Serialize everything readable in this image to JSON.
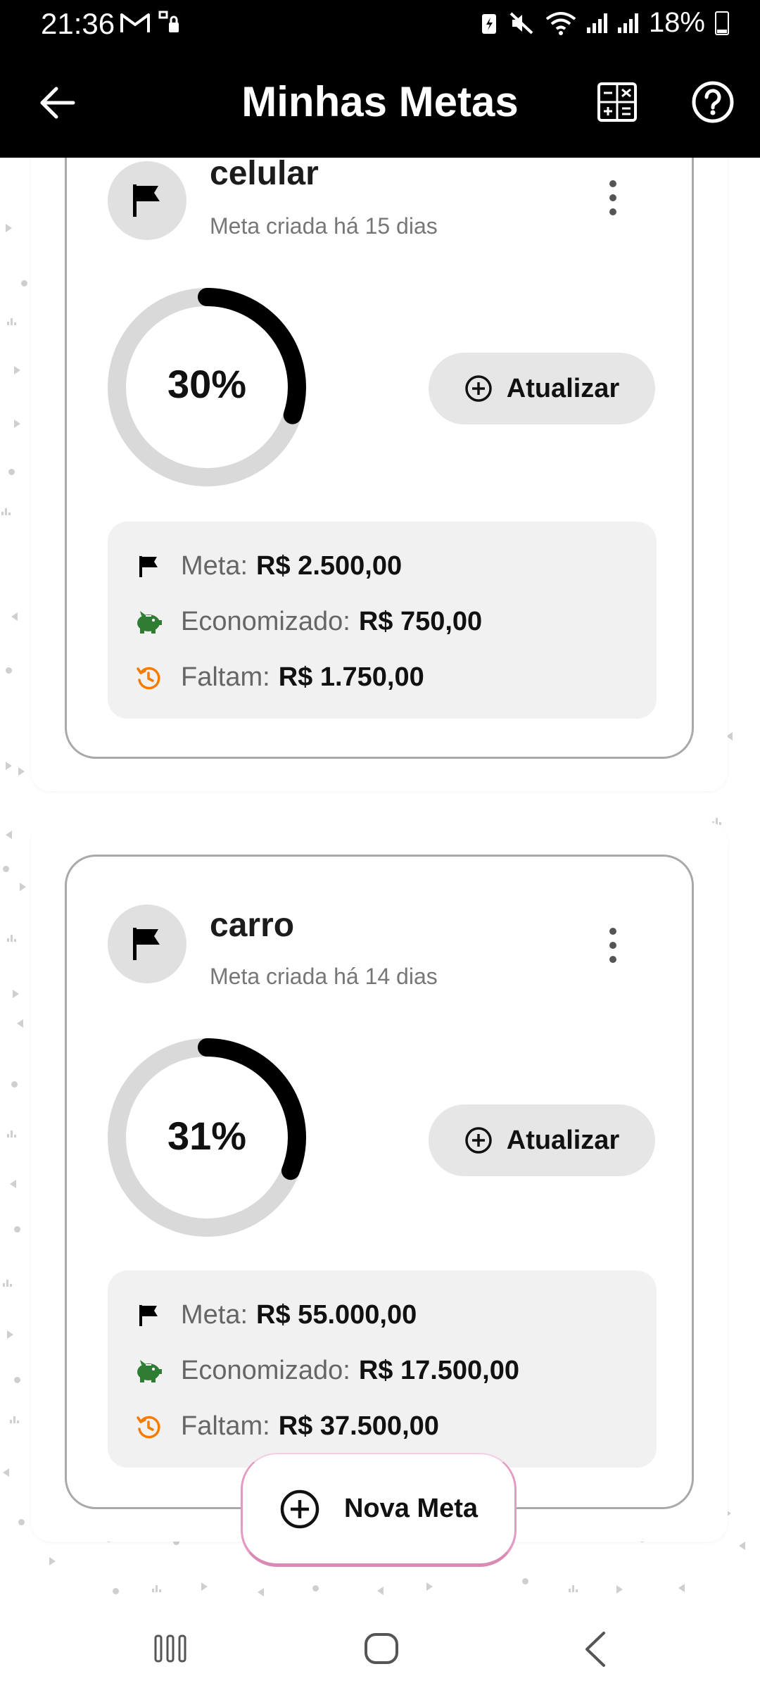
{
  "status_bar": {
    "time": "21:36",
    "battery": "18%"
  },
  "app_bar": {
    "title": "Minhas Metas",
    "back_icon": "arrow-left-icon",
    "calculator_icon": "calculator-icon",
    "help_icon": "help-circle-icon"
  },
  "goals": [
    {
      "name": "celular",
      "created": "Meta criada há 15 dias",
      "percent_label": "30%",
      "progress": 0.3,
      "update_label": "Atualizar",
      "meta_label": "Meta:",
      "meta_value": "R$ 2.500,00",
      "saved_label": "Economizado:",
      "saved_value": "R$ 750,00",
      "remaining_label": "Faltam:",
      "remaining_value": "R$ 1.750,00"
    },
    {
      "name": "carro",
      "created": "Meta criada há 14 dias",
      "percent_label": "31%",
      "progress": 0.31,
      "update_label": "Atualizar",
      "meta_label": "Meta:",
      "meta_value": "R$ 55.000,00",
      "saved_label": "Economizado:",
      "saved_value": "R$ 17.500,00",
      "remaining_label": "Faltam:",
      "remaining_value": "R$ 37.500,00"
    }
  ],
  "fab": {
    "label": "Nova Meta"
  },
  "colors": {
    "progress_fill": "#000000",
    "progress_track": "#d9d9d9",
    "piggy_green": "#2e7d32",
    "clock_orange": "#f57c00",
    "fab_border": "#e39bc3"
  }
}
